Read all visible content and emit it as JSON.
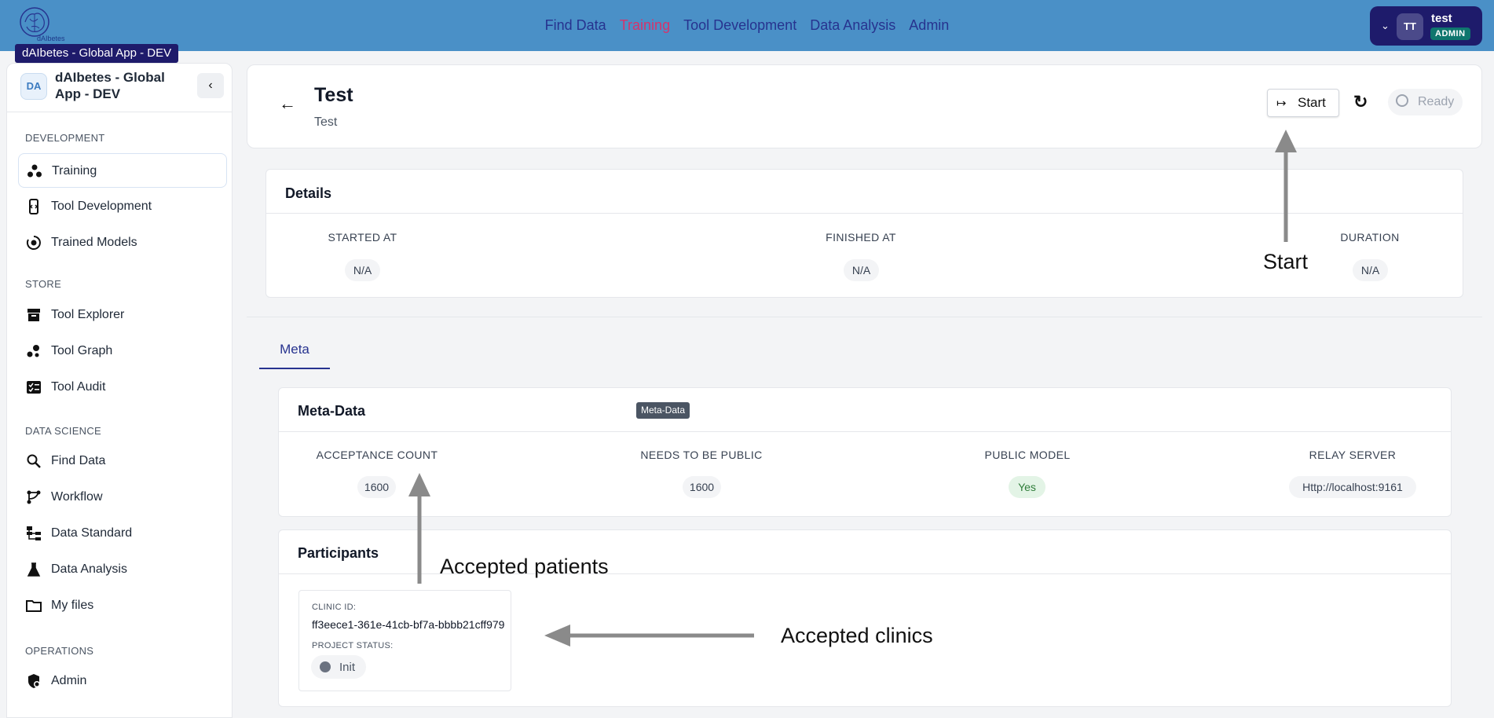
{
  "topbar": {
    "logo_text": "dAIbetes",
    "nav": [
      "Find Data",
      "Training",
      "Tool Development",
      "Data Analysis",
      "Admin"
    ],
    "active_nav": "Training",
    "user": {
      "initials": "TT",
      "name": "test",
      "role": "ADMIN"
    }
  },
  "tooltip": "dAIbetes - Global App - DEV",
  "sidebar": {
    "badge": "DA",
    "title": "dAIbetes - Global App - DEV",
    "sections": {
      "development": "DEVELOPMENT",
      "store": "STORE",
      "data_science": "DATA SCIENCE",
      "operations": "OPERATIONS"
    },
    "items": {
      "training": "Training",
      "tool_development": "Tool Development",
      "trained_models": "Trained Models",
      "tool_explorer": "Tool Explorer",
      "tool_graph": "Tool Graph",
      "tool_audit": "Tool Audit",
      "find_data": "Find Data",
      "workflow": "Workflow",
      "data_standard": "Data Standard",
      "data_analysis": "Data Analysis",
      "my_files": "My files",
      "admin": "Admin"
    }
  },
  "header": {
    "title": "Test",
    "subtitle": "Test",
    "start_label": "Start",
    "status_label": "Ready"
  },
  "details": {
    "title": "Details",
    "started_at_label": "STARTED AT",
    "started_at_value": "N/A",
    "finished_at_label": "FINISHED AT",
    "finished_at_value": "N/A",
    "duration_label": "DURATION",
    "duration_value": "N/A"
  },
  "tabs": {
    "meta": "Meta"
  },
  "meta": {
    "title": "Meta-Data",
    "tooltip": "Meta-Data",
    "acceptance_count_label": "ACCEPTANCE COUNT",
    "acceptance_count_value": "1600",
    "needs_public_label": "NEEDS TO BE PUBLIC",
    "needs_public_value": "1600",
    "public_model_label": "PUBLIC MODEL",
    "public_model_value": "Yes",
    "relay_server_label": "RELAY SERVER",
    "relay_server_value": "Http://localhost:9161"
  },
  "participants": {
    "title": "Participants",
    "clinic_id_label": "CLINIC ID:",
    "clinic_id_value": "ff3eece1-361e-41cb-bf7a-bbbb21cff979",
    "project_status_label": "PROJECT STATUS:",
    "project_status_value": "Init"
  },
  "annotations": {
    "start": "Start",
    "accepted_patients": "Accepted patients",
    "accepted_clinics": "Accepted clinics"
  },
  "colors": {
    "topbar": "#4a90c7",
    "nav_text": "#27338f",
    "nav_active": "#d6336c",
    "user_box": "#1e1b6b",
    "admin_badge": "#0f766e",
    "yes_pill": "#e3f4e6"
  }
}
